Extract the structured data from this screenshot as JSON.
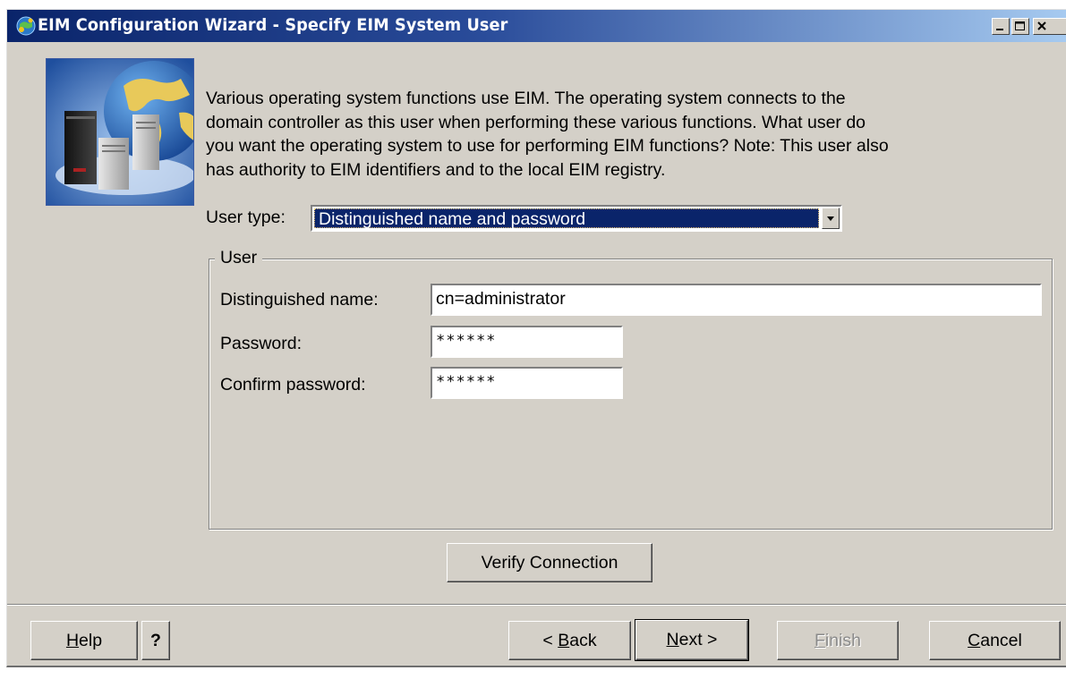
{
  "window": {
    "title": "EIM Configuration Wizard -  Specify EIM System User",
    "controls": {
      "minimize": "minimize",
      "maximize": "maximize",
      "close": "close"
    }
  },
  "intro": {
    "line1": "Various operating system functions use EIM. The operating system connects to the",
    "line2": "domain controller as this user when performing these various functions. What user do",
    "line3": "you want the operating system to use for performing EIM functions?  Note: This user also",
    "line4": "has authority to EIM identifiers and to the local EIM registry."
  },
  "user_type": {
    "label": "User type:",
    "selected": "Distinguished name and password"
  },
  "user_group": {
    "legend": "User",
    "dn_label": "Distinguished name:",
    "dn_value": "cn=administrator",
    "password_label": "Password:",
    "password_value": "******",
    "confirm_label": "Confirm password:",
    "confirm_value": "******"
  },
  "verify_button": "Verify Connection",
  "footer": {
    "help_label": "elp",
    "help_mnemonic": "H",
    "whats_this": "?",
    "back_prefix": "< ",
    "back_mnemonic": "B",
    "back_rest": "ack",
    "next_mnemonic": "N",
    "next_rest": "ext >",
    "finish_mnemonic": "F",
    "finish_rest": "inish",
    "cancel_mnemonic": "C",
    "cancel_rest": "ancel"
  },
  "colors": {
    "titlebar_start": "#0a246a",
    "titlebar_end": "#a6caf0",
    "dialog_face": "#d4d0c8",
    "selection": "#0a246a"
  },
  "icons": [
    "wizard-app-icon",
    "minimize-icon",
    "maximize-icon",
    "close-icon",
    "dropdown-arrow-icon",
    "globe-servers-illustration"
  ]
}
